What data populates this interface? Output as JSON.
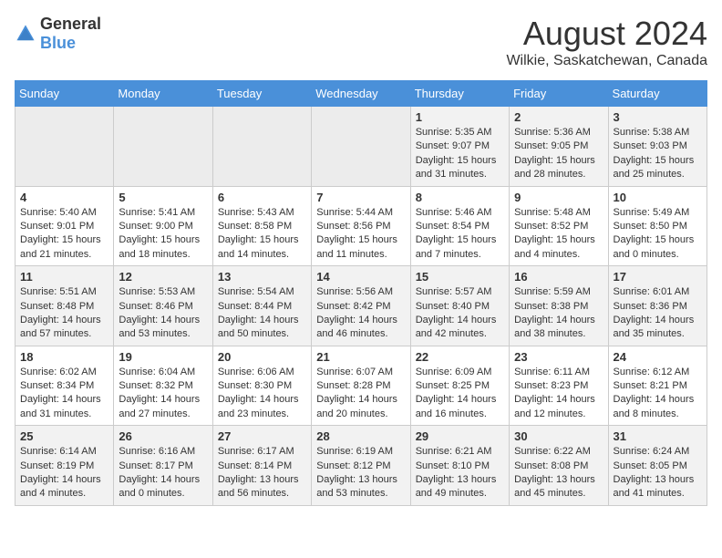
{
  "header": {
    "logo_general": "General",
    "logo_blue": "Blue",
    "month_year": "August 2024",
    "location": "Wilkie, Saskatchewan, Canada"
  },
  "calendar": {
    "days_of_week": [
      "Sunday",
      "Monday",
      "Tuesday",
      "Wednesday",
      "Thursday",
      "Friday",
      "Saturday"
    ],
    "weeks": [
      [
        {
          "day": "",
          "info": ""
        },
        {
          "day": "",
          "info": ""
        },
        {
          "day": "",
          "info": ""
        },
        {
          "day": "",
          "info": ""
        },
        {
          "day": "1",
          "info": "Sunrise: 5:35 AM\nSunset: 9:07 PM\nDaylight: 15 hours\nand 31 minutes."
        },
        {
          "day": "2",
          "info": "Sunrise: 5:36 AM\nSunset: 9:05 PM\nDaylight: 15 hours\nand 28 minutes."
        },
        {
          "day": "3",
          "info": "Sunrise: 5:38 AM\nSunset: 9:03 PM\nDaylight: 15 hours\nand 25 minutes."
        }
      ],
      [
        {
          "day": "4",
          "info": "Sunrise: 5:40 AM\nSunset: 9:01 PM\nDaylight: 15 hours\nand 21 minutes."
        },
        {
          "day": "5",
          "info": "Sunrise: 5:41 AM\nSunset: 9:00 PM\nDaylight: 15 hours\nand 18 minutes."
        },
        {
          "day": "6",
          "info": "Sunrise: 5:43 AM\nSunset: 8:58 PM\nDaylight: 15 hours\nand 14 minutes."
        },
        {
          "day": "7",
          "info": "Sunrise: 5:44 AM\nSunset: 8:56 PM\nDaylight: 15 hours\nand 11 minutes."
        },
        {
          "day": "8",
          "info": "Sunrise: 5:46 AM\nSunset: 8:54 PM\nDaylight: 15 hours\nand 7 minutes."
        },
        {
          "day": "9",
          "info": "Sunrise: 5:48 AM\nSunset: 8:52 PM\nDaylight: 15 hours\nand 4 minutes."
        },
        {
          "day": "10",
          "info": "Sunrise: 5:49 AM\nSunset: 8:50 PM\nDaylight: 15 hours\nand 0 minutes."
        }
      ],
      [
        {
          "day": "11",
          "info": "Sunrise: 5:51 AM\nSunset: 8:48 PM\nDaylight: 14 hours\nand 57 minutes."
        },
        {
          "day": "12",
          "info": "Sunrise: 5:53 AM\nSunset: 8:46 PM\nDaylight: 14 hours\nand 53 minutes."
        },
        {
          "day": "13",
          "info": "Sunrise: 5:54 AM\nSunset: 8:44 PM\nDaylight: 14 hours\nand 50 minutes."
        },
        {
          "day": "14",
          "info": "Sunrise: 5:56 AM\nSunset: 8:42 PM\nDaylight: 14 hours\nand 46 minutes."
        },
        {
          "day": "15",
          "info": "Sunrise: 5:57 AM\nSunset: 8:40 PM\nDaylight: 14 hours\nand 42 minutes."
        },
        {
          "day": "16",
          "info": "Sunrise: 5:59 AM\nSunset: 8:38 PM\nDaylight: 14 hours\nand 38 minutes."
        },
        {
          "day": "17",
          "info": "Sunrise: 6:01 AM\nSunset: 8:36 PM\nDaylight: 14 hours\nand 35 minutes."
        }
      ],
      [
        {
          "day": "18",
          "info": "Sunrise: 6:02 AM\nSunset: 8:34 PM\nDaylight: 14 hours\nand 31 minutes."
        },
        {
          "day": "19",
          "info": "Sunrise: 6:04 AM\nSunset: 8:32 PM\nDaylight: 14 hours\nand 27 minutes."
        },
        {
          "day": "20",
          "info": "Sunrise: 6:06 AM\nSunset: 8:30 PM\nDaylight: 14 hours\nand 23 minutes."
        },
        {
          "day": "21",
          "info": "Sunrise: 6:07 AM\nSunset: 8:28 PM\nDaylight: 14 hours\nand 20 minutes."
        },
        {
          "day": "22",
          "info": "Sunrise: 6:09 AM\nSunset: 8:25 PM\nDaylight: 14 hours\nand 16 minutes."
        },
        {
          "day": "23",
          "info": "Sunrise: 6:11 AM\nSunset: 8:23 PM\nDaylight: 14 hours\nand 12 minutes."
        },
        {
          "day": "24",
          "info": "Sunrise: 6:12 AM\nSunset: 8:21 PM\nDaylight: 14 hours\nand 8 minutes."
        }
      ],
      [
        {
          "day": "25",
          "info": "Sunrise: 6:14 AM\nSunset: 8:19 PM\nDaylight: 14 hours\nand 4 minutes."
        },
        {
          "day": "26",
          "info": "Sunrise: 6:16 AM\nSunset: 8:17 PM\nDaylight: 14 hours\nand 0 minutes."
        },
        {
          "day": "27",
          "info": "Sunrise: 6:17 AM\nSunset: 8:14 PM\nDaylight: 13 hours\nand 56 minutes."
        },
        {
          "day": "28",
          "info": "Sunrise: 6:19 AM\nSunset: 8:12 PM\nDaylight: 13 hours\nand 53 minutes."
        },
        {
          "day": "29",
          "info": "Sunrise: 6:21 AM\nSunset: 8:10 PM\nDaylight: 13 hours\nand 49 minutes."
        },
        {
          "day": "30",
          "info": "Sunrise: 6:22 AM\nSunset: 8:08 PM\nDaylight: 13 hours\nand 45 minutes."
        },
        {
          "day": "31",
          "info": "Sunrise: 6:24 AM\nSunset: 8:05 PM\nDaylight: 13 hours\nand 41 minutes."
        }
      ]
    ]
  }
}
